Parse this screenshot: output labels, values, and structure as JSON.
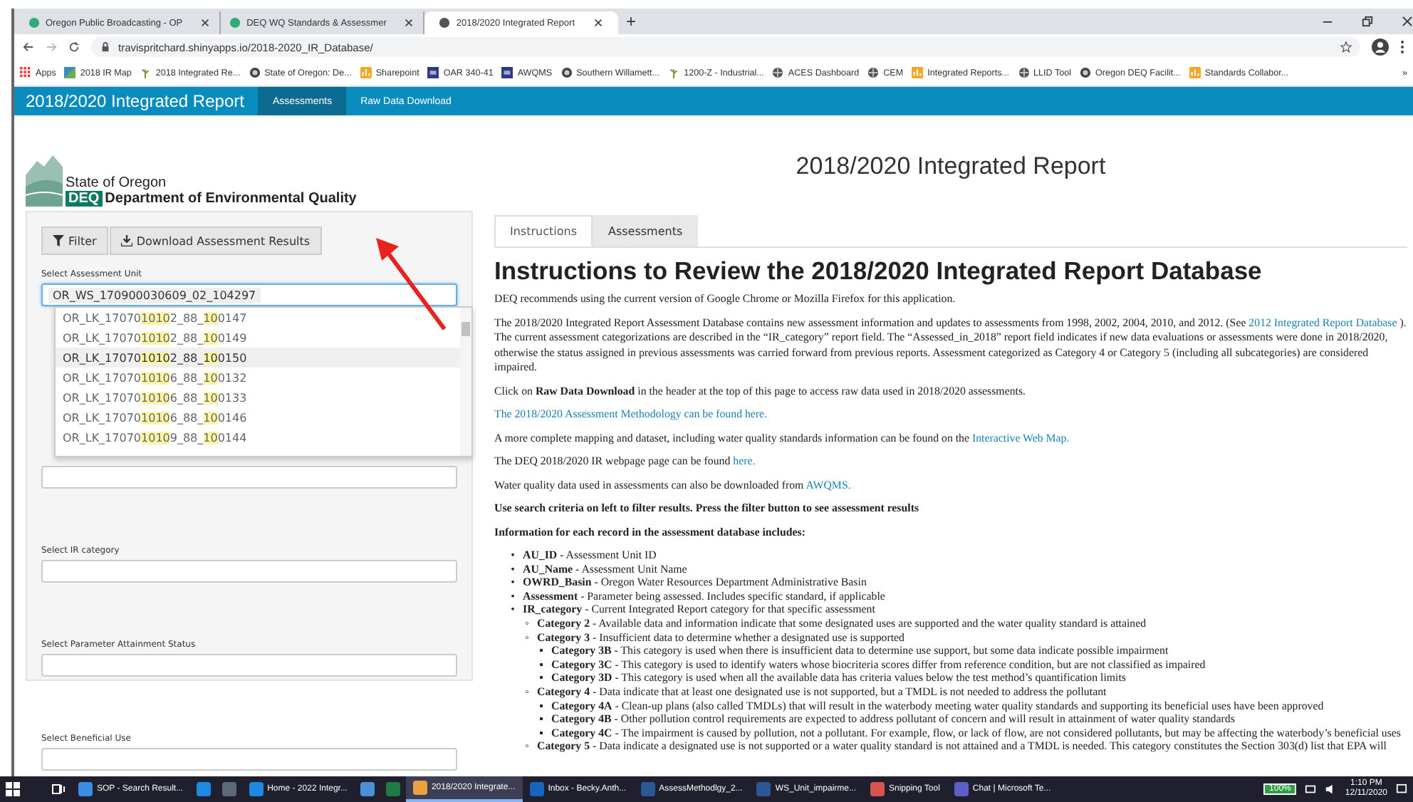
{
  "browser": {
    "tabs": [
      {
        "title": "Oregon Public Broadcasting - OP",
        "selected": false
      },
      {
        "title": "DEQ WQ Standards & Assessmer",
        "selected": false
      },
      {
        "title": "2018/2020 Integrated Report",
        "selected": true
      }
    ],
    "new_tab": "+",
    "url": "travispritchard.shinyapps.io/2018-2020_IR_Database/",
    "bookmarks": [
      {
        "label": "Apps",
        "kind": "apps"
      },
      {
        "label": "2018 IR Map",
        "kind": "map"
      },
      {
        "label": "2018 Integrated Re...",
        "kind": "leaf"
      },
      {
        "label": "State of Oregon: De...",
        "kind": "seal"
      },
      {
        "label": "Sharepoint",
        "kind": "tile"
      },
      {
        "label": "OAR 340-41",
        "kind": "square"
      },
      {
        "label": "AWQMS",
        "kind": "square"
      },
      {
        "label": "Southern Willamett...",
        "kind": "seal"
      },
      {
        "label": "1200-Z - Industrial...",
        "kind": "leaf"
      },
      {
        "label": "ACES Dashboard",
        "kind": "globe"
      },
      {
        "label": "CEM",
        "kind": "globe"
      },
      {
        "label": "Integrated Reports...",
        "kind": "tile"
      },
      {
        "label": "LLID Tool",
        "kind": "globe"
      },
      {
        "label": "Oregon DEQ Facilit...",
        "kind": "seal"
      },
      {
        "label": "Standards Collabor...",
        "kind": "tile"
      }
    ],
    "bookmarks_overflow": "»"
  },
  "navbar": {
    "brand": "2018/2020 Integrated Report",
    "items": [
      {
        "label": "Assessments",
        "selected": true
      },
      {
        "label": "Raw Data Download",
        "selected": false
      }
    ]
  },
  "sidebar": {
    "logo": {
      "line1": "State of Oregon",
      "badge": "DEQ",
      "line2": "Department of Environmental Quality"
    },
    "buttons": [
      {
        "label": "Filter",
        "kind": "filter"
      },
      {
        "label": "Download Assessment Results",
        "kind": "download"
      }
    ],
    "assessment_unit": {
      "label": "Select Assessment Unit",
      "value": "OR_WS_170900030609_02_104297",
      "focused": true
    },
    "dropdown": [
      {
        "selected": false,
        "parts": [
          {
            "text": "OR_LK_17070",
            "hit": false
          },
          {
            "text": "1010",
            "hit": true
          },
          {
            "text": "2_88_",
            "hit": false
          },
          {
            "text": "10",
            "hit": true
          },
          {
            "text": "0147",
            "hit": false
          }
        ]
      },
      {
        "selected": false,
        "parts": [
          {
            "text": "OR_LK_17070",
            "hit": false
          },
          {
            "text": "1010",
            "hit": true
          },
          {
            "text": "2_88_",
            "hit": false
          },
          {
            "text": "10",
            "hit": true
          },
          {
            "text": "0149",
            "hit": false
          }
        ]
      },
      {
        "selected": true,
        "parts": [
          {
            "text": "OR_LK_17070",
            "hit": false
          },
          {
            "text": "1010",
            "hit": true
          },
          {
            "text": "2_88_",
            "hit": false
          },
          {
            "text": "10",
            "hit": true
          },
          {
            "text": "0150",
            "hit": false
          }
        ]
      },
      {
        "selected": false,
        "parts": [
          {
            "text": "OR_LK_17070",
            "hit": false
          },
          {
            "text": "1010",
            "hit": true
          },
          {
            "text": "6_88_",
            "hit": false
          },
          {
            "text": "10",
            "hit": true
          },
          {
            "text": "0132",
            "hit": false
          }
        ]
      },
      {
        "selected": false,
        "parts": [
          {
            "text": "OR_LK_17070",
            "hit": false
          },
          {
            "text": "1010",
            "hit": true
          },
          {
            "text": "6_88_",
            "hit": false
          },
          {
            "text": "10",
            "hit": true
          },
          {
            "text": "0133",
            "hit": false
          }
        ]
      },
      {
        "selected": false,
        "parts": [
          {
            "text": "OR_LK_17070",
            "hit": false
          },
          {
            "text": "1010",
            "hit": true
          },
          {
            "text": "6_88_",
            "hit": false
          },
          {
            "text": "10",
            "hit": true
          },
          {
            "text": "0146",
            "hit": false
          }
        ]
      },
      {
        "selected": false,
        "parts": [
          {
            "text": "OR_LK_17070",
            "hit": false
          },
          {
            "text": "1010",
            "hit": true
          },
          {
            "text": "9_88_",
            "hit": false
          },
          {
            "text": "10",
            "hit": true
          },
          {
            "text": "0144",
            "hit": false
          }
        ]
      }
    ],
    "filters": [
      {
        "label": "Select IR category"
      },
      {
        "label": "Select Parameter Attainment Status"
      },
      {
        "label": "Select Beneficial Use"
      }
    ]
  },
  "main": {
    "title": "2018/2020 Integrated Report",
    "tabs": [
      {
        "label": "Instructions",
        "selected": true
      },
      {
        "label": "Assessments",
        "selected": false
      }
    ],
    "heading": "Instructions to Review the 2018/2020 Integrated Report Database",
    "paragraphs": [
      [
        {
          "kind": "text",
          "text": "DEQ recommends using the current version of Google Chrome or Mozilla Firefox for this application."
        }
      ],
      [
        {
          "kind": "text",
          "text": "The 2018/2020 Integrated Report Assessment Database contains new assessment information and updates to assessments from 1998, 2002, 2004, 2010, and 2012. (See "
        },
        {
          "kind": "link",
          "text": "2012 Integrated Report Database"
        },
        {
          "kind": "text",
          "text": " ). The current assessment categorizations are described in the “IR_category” report field. The “Assessed_in_2018” report field indicates if new data evaluations or assessments were done in 2018/2020, otherwise the status assigned in previous assessments was carried forward from previous reports. Assessment categorized as Category 4 or Category 5 (including all subcategories) are considered impaired."
        }
      ],
      [
        {
          "kind": "text",
          "text": "Click on "
        },
        {
          "kind": "bold",
          "text": "Raw Data Download"
        },
        {
          "kind": "text",
          "text": " in the header at the top of this page to access raw data used in 2018/2020 assessments."
        }
      ],
      [
        {
          "kind": "link",
          "text": "The 2018/2020 Assessment Methodology can be found here."
        }
      ],
      [
        {
          "kind": "text",
          "text": "A more complete mapping and dataset, including water quality standards information can be found on the "
        },
        {
          "kind": "link",
          "text": "Interactive Web Map."
        }
      ],
      [
        {
          "kind": "text",
          "text": "The DEQ 2018/2020 IR webpage page can be found "
        },
        {
          "kind": "link",
          "text": "here."
        }
      ],
      [
        {
          "kind": "text",
          "text": "Water quality data used in assessments can also be downloaded from "
        },
        {
          "kind": "link",
          "text": "AWQMS."
        }
      ],
      [
        {
          "kind": "bold",
          "text": "Use search criteria on left to filter results. Press the filter button to see assessment results"
        }
      ],
      [
        {
          "kind": "bold",
          "text": "Information for each record in the assessment database includes:"
        }
      ]
    ],
    "list_markers": [
      "•",
      "◦",
      "▪"
    ],
    "list": [
      {
        "term": "AU_ID",
        "text": "- Assessment Unit ID"
      },
      {
        "term": "AU_Name",
        "text": "- Assessment Unit Name"
      },
      {
        "term": "OWRD_Basin",
        "text": "- Oregon Water Resources Department Administrative Basin"
      },
      {
        "term": "Assessment",
        "text": "- Parameter being assessed. Includes specific standard, if applicable"
      },
      {
        "term": "IR_category",
        "text": "- Current Integrated Report category for that specific assessment",
        "children": [
          {
            "term": "Category 2",
            "text": "- Available data and information indicate that some designated uses are supported and the water quality standard is attained"
          },
          {
            "term": "Category 3",
            "text": "- Insufficient data to determine whether a designated use is supported",
            "children": [
              {
                "term": "Category 3B",
                "text": "- This category is used when there is insufficient data to determine use support, but some data indicate possible impairment"
              },
              {
                "term": "Category 3C",
                "text": "- This category is used to identify waters whose biocriteria scores differ from reference condition, but are not classified as impaired"
              },
              {
                "term": "Category 3D",
                "text": "- This category is used when all the available data has criteria values below the test method’s quantification limits"
              }
            ]
          },
          {
            "term": "Category 4",
            "text": "- Data indicate that at least one designated use is not supported, but a TMDL is not needed to address the pollutant",
            "children": [
              {
                "term": "Category 4A",
                "text": "- Clean-up plans (also called TMDLs) that will result in the waterbody meeting water quality standards and supporting its beneficial uses have been approved"
              },
              {
                "term": "Category 4B",
                "text": "- Other pollution control requirements are expected to address pollutant of concern and will result in attainment of water quality standards"
              },
              {
                "term": "Category 4C",
                "text": "- The impairment is caused by pollution, not a pollutant. For example, flow, or lack of flow, are not considered pollutants, but may be affecting the waterbody’s beneficial uses"
              }
            ]
          },
          {
            "term": "Category 5",
            "text": "- Data indicate a designated use is not supported or a water quality standard is not attained and a TMDL is needed. This category constitutes the Section 303(d) list that EPA will"
          }
        ]
      }
    ]
  },
  "taskbar": {
    "items": [
      {
        "kind": "app",
        "label": "SOP - Search Result...",
        "color": "#3a8ee6",
        "selected": false
      },
      {
        "kind": "pinned",
        "color": "#1e88e5",
        "selected": false
      },
      {
        "kind": "pinned",
        "color": "#5a6a78",
        "selected": false
      },
      {
        "kind": "app",
        "label": "Home - 2022 Integr...",
        "color": "#1e88e5",
        "selected": false
      },
      {
        "kind": "pinned",
        "color": "#4a90d9",
        "selected": false
      },
      {
        "kind": "pinned",
        "color": "#1f7a45",
        "selected": false
      },
      {
        "kind": "app",
        "label": "2018/2020 Integrate...",
        "color": "#e8a33d",
        "selected": true
      },
      {
        "kind": "app",
        "label": "Inbox - Becky.Anth...",
        "color": "#1565c0",
        "selected": false
      },
      {
        "kind": "app",
        "label": "AssessMethodlgy_2...",
        "color": "#2b5797",
        "selected": false
      },
      {
        "kind": "app",
        "label": "WS_Unit_impairme...",
        "color": "#2b5797",
        "selected": false
      },
      {
        "kind": "app",
        "label": "Snipping Tool",
        "color": "#d9534f",
        "selected": false
      },
      {
        "kind": "app",
        "label": "Chat | Microsoft Te...",
        "color": "#5b5fc7",
        "selected": false
      }
    ],
    "zoom": "100%",
    "time": "1:10 PM",
    "date": "12/11/2020"
  }
}
